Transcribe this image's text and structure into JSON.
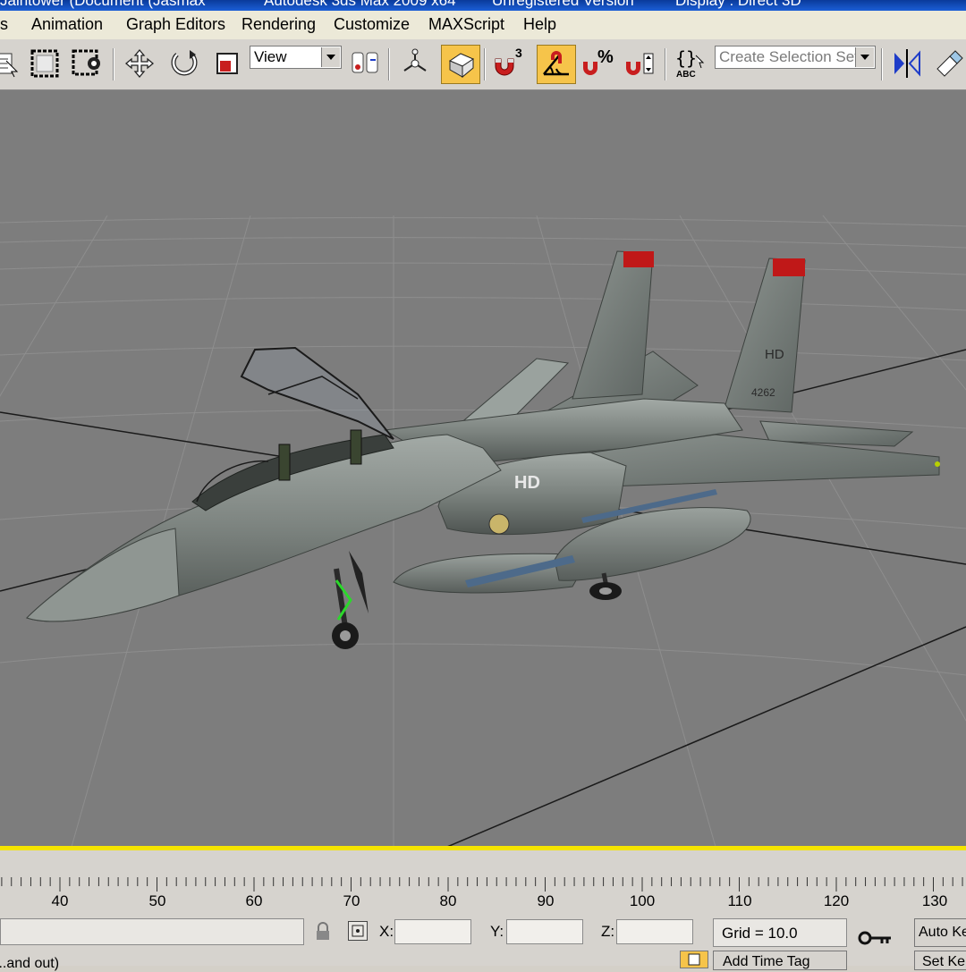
{
  "window": {
    "title_fragments": [
      "Jaintower (Document (Jasmax",
      "Autodesk 3ds Max 2009 x64",
      "Unregistered Version",
      "Display : Direct 3D"
    ]
  },
  "menubar": {
    "items": [
      "rs",
      "Animation",
      "Graph Editors",
      "Rendering",
      "Customize",
      "MAXScript",
      "Help"
    ]
  },
  "toolbar": {
    "reference_coord": "View",
    "selection_set_placeholder": "Create Selection Set",
    "icons": [
      "select-by-name-icon",
      "rectangular-selection-icon",
      "window-crossing-icon",
      "move-icon",
      "rotate-icon",
      "scale-icon",
      "pivot-icon",
      "manipulate-icon",
      "keyboard-shortcut-icon",
      "snap-3d-icon",
      "angle-snap-icon",
      "percent-snap-icon",
      "spinner-snap-icon",
      "edit-named-selection-icon",
      "mirror-icon",
      "align-icon"
    ],
    "snap_label": "3",
    "active_color": "#f6c44a"
  },
  "viewport": {
    "background": "#7d7d7d",
    "border_color": "#f4e400",
    "aircraft_markings": {
      "tail_code": "HD",
      "tail_number": "4262",
      "nose_code": "HD"
    }
  },
  "timeline": {
    "ticks": [
      "40",
      "50",
      "60",
      "70",
      "80",
      "90",
      "100",
      "110",
      "120",
      "130"
    ]
  },
  "status": {
    "prompt": "...and out)",
    "x_label": "X:",
    "y_label": "Y:",
    "z_label": "Z:",
    "grid": "Grid = 10.0",
    "auto_key": "Auto Ke",
    "set_key": "Set Ke",
    "add_time_tag": "Add Time Tag"
  }
}
